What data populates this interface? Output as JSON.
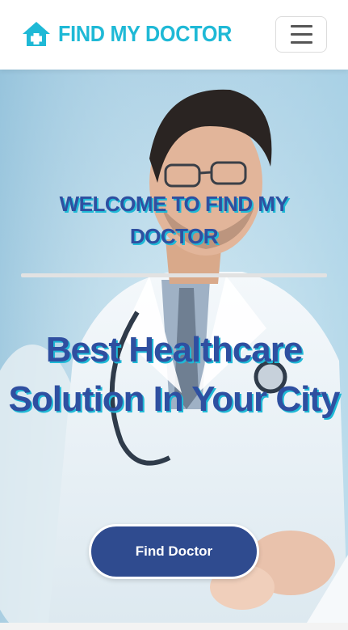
{
  "colors": {
    "brand": "#1fb9d6",
    "heading": "#2f4fa0",
    "button": "#2f4b8f",
    "divider": "#e2e2e2"
  },
  "navbar": {
    "brand_icon": "home-plus-icon",
    "brand_text": "FIND MY DOCTOR",
    "toggler_icon": "hamburger-menu-icon"
  },
  "hero": {
    "background": "doctor-photo",
    "welcome": "WELCOME TO FIND MY DOCTOR",
    "headline": "Best Healthcare Solution In Your City",
    "cta_label": "Find Doctor"
  }
}
